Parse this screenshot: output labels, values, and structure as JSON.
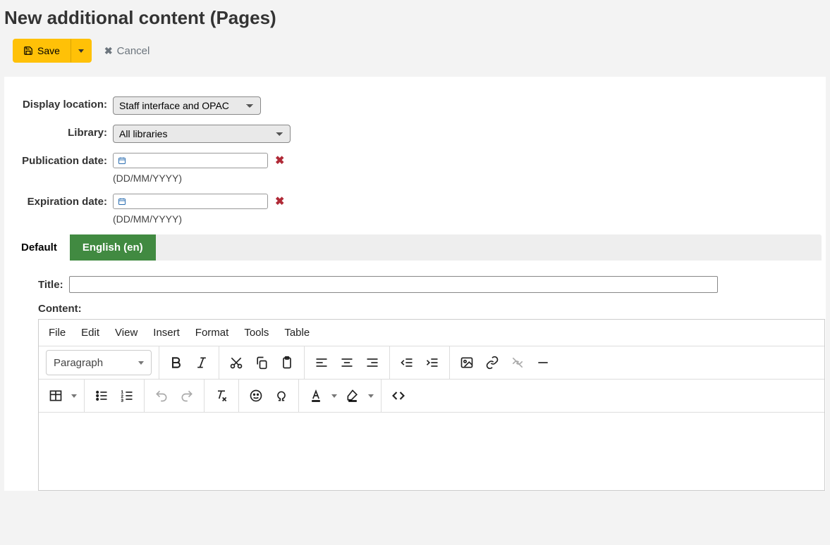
{
  "page": {
    "title": "New additional content (Pages)"
  },
  "actions": {
    "save_label": "Save",
    "cancel_label": "Cancel"
  },
  "form": {
    "display_location": {
      "label": "Display location:",
      "value": "Staff interface and OPAC"
    },
    "library": {
      "label": "Library:",
      "value": "All libraries"
    },
    "publication_date": {
      "label": "Publication date:",
      "value": "",
      "hint": "(DD/MM/YYYY)"
    },
    "expiration_date": {
      "label": "Expiration date:",
      "value": "",
      "hint": "(DD/MM/YYYY)"
    }
  },
  "tabs": {
    "default": "Default",
    "english": "English (en)"
  },
  "content": {
    "title_label": "Title:",
    "title_value": "",
    "content_label": "Content:"
  },
  "editor": {
    "menubar": [
      "File",
      "Edit",
      "View",
      "Insert",
      "Format",
      "Tools",
      "Table"
    ],
    "block_label": "Paragraph"
  }
}
